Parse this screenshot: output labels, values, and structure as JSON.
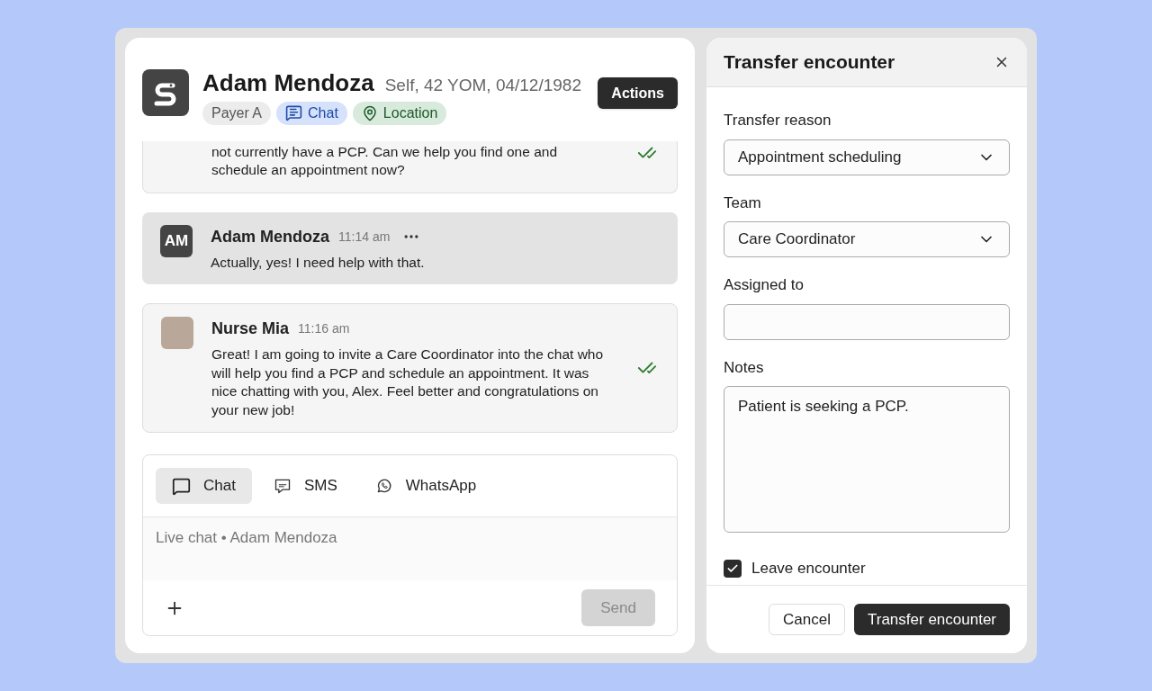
{
  "patient": {
    "name": "Adam Mendoza",
    "details": "Self, 42 YOM, 04/12/1982",
    "tags": [
      {
        "kind": "payer",
        "label": "Payer A"
      },
      {
        "kind": "chat",
        "label": "Chat"
      },
      {
        "kind": "location",
        "label": "Location"
      }
    ],
    "actions_button": "Actions"
  },
  "messages": [
    {
      "kind": "outgoing",
      "partial": true,
      "text": "not currently have a PCP. Can we help you find one and schedule an appointment now?",
      "read": true
    },
    {
      "kind": "incoming",
      "initials": "AM",
      "sender": "Adam Mendoza",
      "time": "11:14 am",
      "menu": true,
      "text": "Actually, yes! I need help with that.",
      "read": false
    },
    {
      "kind": "outgoing",
      "photo": true,
      "sender": "Nurse Mia",
      "time": "11:16 am",
      "menu": false,
      "text": "Great! I am going to invite a Care Coordinator into the chat who will help you find a PCP and schedule an appointment. It was nice chatting with you, Alex. Feel better and congratulations on your new job!",
      "read": true
    }
  ],
  "composer": {
    "channels": [
      {
        "kind": "chat",
        "label": "Chat",
        "selected": true
      },
      {
        "kind": "sms",
        "label": "SMS",
        "selected": false
      },
      {
        "kind": "whatsapp",
        "label": "WhatsApp",
        "selected": false
      }
    ],
    "placeholder": "Live chat • Adam Mendoza",
    "send_button": "Send",
    "send_disabled": true
  },
  "transfer": {
    "title": "Transfer encounter",
    "fields": [
      {
        "kind": "select",
        "label": "Transfer reason",
        "value": "Appointment scheduling"
      },
      {
        "kind": "select",
        "label": "Team",
        "value": "Care Coordinator"
      },
      {
        "kind": "input",
        "label": "Assigned to"
      },
      {
        "kind": "textarea",
        "label": "Notes",
        "value": "Patient is seeking a PCP."
      }
    ],
    "leave": {
      "label": "Leave encounter",
      "checked": true
    },
    "cancel_button": "Cancel",
    "submit_button": "Transfer encounter"
  }
}
